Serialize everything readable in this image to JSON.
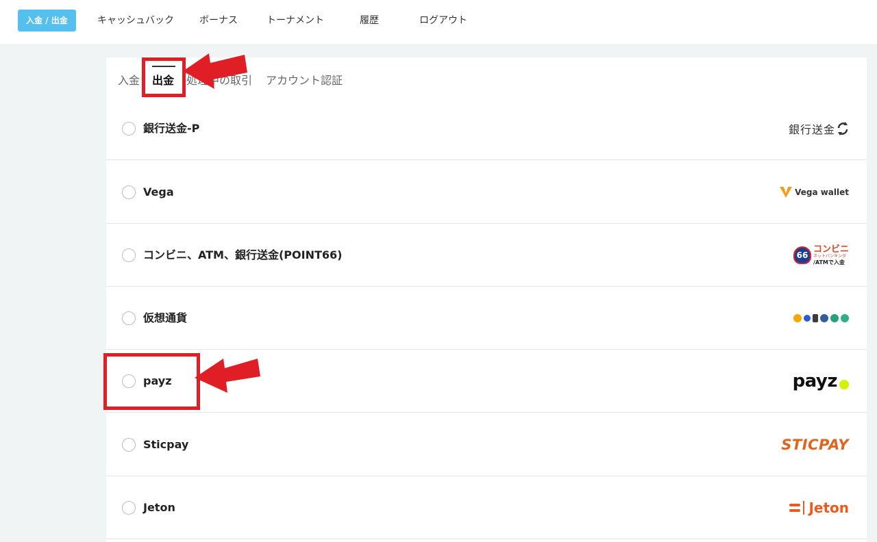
{
  "nav": {
    "items": [
      {
        "label": "入金 / 出金",
        "active": true
      },
      {
        "label": "キャッシュバック"
      },
      {
        "label": "ボーナス"
      },
      {
        "label": "トーナメント"
      },
      {
        "label": "履歴"
      },
      {
        "label": "ログアウト"
      }
    ]
  },
  "tabs": [
    {
      "label": "入金"
    },
    {
      "label": "出金",
      "active": true
    },
    {
      "label": "処理中の取引"
    },
    {
      "label": "アカウント認証"
    }
  ],
  "methods": [
    {
      "label": "銀行送金-P",
      "logo_text": "銀行送金",
      "icon": "refresh-icon"
    },
    {
      "label": "Vega",
      "logo_text": "Vega wallet",
      "icon": "vega-icon"
    },
    {
      "label": "コンビニ、ATM、銀行送金(POINT66)",
      "logo_text": {
        "badge": "66",
        "line1": "コンビニ",
        "line2": "ネットバンキング",
        "line3": "/ATMで入金"
      }
    },
    {
      "label": "仮想通貨",
      "coins": [
        "bitcoin-icon",
        "ripple-icon",
        "ethereum-icon",
        "litecoin-icon",
        "tether-icon",
        "tron-icon"
      ]
    },
    {
      "label": "payz",
      "logo_text": "payz"
    },
    {
      "label": "Sticpay",
      "logo_text": "STICPAY"
    },
    {
      "label": "Jeton",
      "logo_text": "Jeton"
    }
  ],
  "colors": {
    "accent": "#55c0ee",
    "highlight": "#e01e26",
    "sticpay": "#e0641c",
    "jeton": "#ec5a1e",
    "payz_dot": "#d4f200"
  }
}
